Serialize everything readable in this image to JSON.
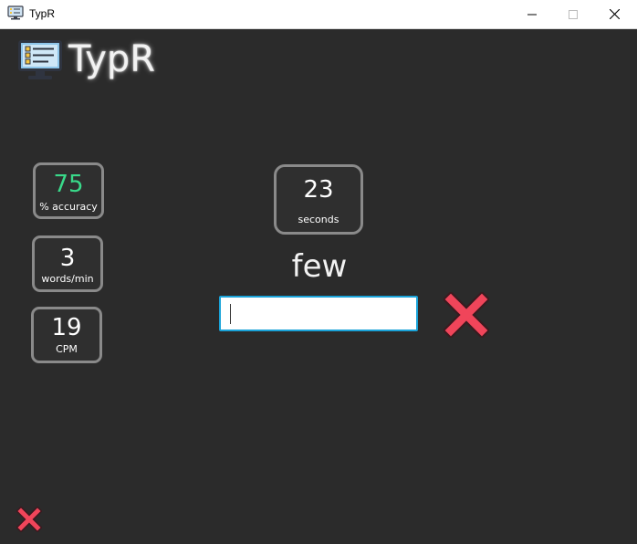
{
  "window": {
    "title": "TypR",
    "controls": {
      "minimize": "minimize-icon",
      "maximize": "maximize-icon",
      "close": "close-icon"
    }
  },
  "header": {
    "brand": "TypR",
    "logo_icon": "monitor-checklist-icon"
  },
  "stats": {
    "accuracy": {
      "value": "75",
      "label": "% accuracy",
      "color": "#39d98a"
    },
    "wpm": {
      "value": "3",
      "label": "words/min"
    },
    "cpm": {
      "value": "19",
      "label": "CPM"
    }
  },
  "timer": {
    "value": "23",
    "label": "seconds"
  },
  "current_word": "few",
  "input": {
    "value": "",
    "placeholder": ""
  },
  "status": {
    "icon": "incorrect-x-icon",
    "color": "#f0455a"
  },
  "footer": {
    "exit_icon": "exit-x-icon"
  },
  "colors": {
    "background": "#2b2b2b",
    "stat_border": "#8a8a8a",
    "input_border": "#1aa3d9",
    "error": "#f0455a"
  }
}
